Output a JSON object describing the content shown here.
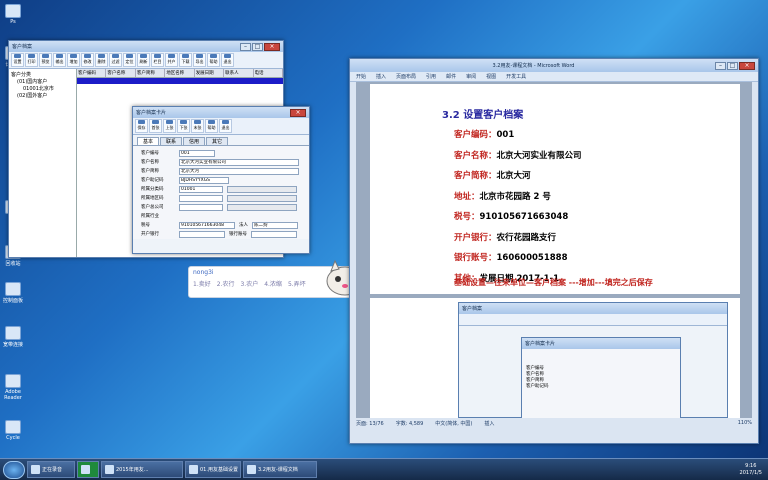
{
  "desktop": {
    "icons": [
      "Ps",
      "计算机",
      "网络",
      "回收站",
      "控制面板",
      "宽带连接",
      "Adobe Reader",
      "Cycle"
    ]
  },
  "archive_window": {
    "title": "客户档案",
    "toolbar": [
      "设置",
      "打印",
      "预览",
      "输出",
      "增加",
      "修改",
      "删除",
      "过滤",
      "定位",
      "刷新",
      "栏目",
      "并户",
      "下载",
      "导出",
      "帮助",
      "退出"
    ],
    "tree": {
      "root": "客户分类",
      "items": [
        "(01)国内客户",
        "01001北京市",
        "(02)国外客户"
      ]
    },
    "columns": [
      "客户编码",
      "客户名称",
      "客户简称",
      "地区名称",
      "发展日期",
      "联系人",
      "电话"
    ]
  },
  "card_window": {
    "title": "客户档案卡片",
    "toolbar": [
      "保存",
      "首张",
      "上张",
      "下张",
      "末张",
      "帮助",
      "退出"
    ],
    "tabs": [
      "基本",
      "联系",
      "信用",
      "其它"
    ],
    "fields": [
      {
        "label": "客户编号",
        "value": "001"
      },
      {
        "label": "客户名称",
        "value": "北京大河实业有限公司"
      },
      {
        "label": "客户简称",
        "value": "北京大河"
      },
      {
        "label": "客户助记码",
        "value": "BJDHSYYXGS"
      },
      {
        "label": "所属分类码",
        "value": "01001"
      },
      {
        "label": "所属地区码",
        "value": ""
      },
      {
        "label": "客户总公司",
        "value": ""
      },
      {
        "label": "所属行业",
        "value": ""
      }
    ],
    "tax": {
      "label": "税号",
      "value": "910105671663048"
    },
    "legal": {
      "label": "法人",
      "value": "陈二狗"
    },
    "bank": {
      "label": "开户银行",
      "value": ""
    },
    "account": {
      "label": "银行账号",
      "value": ""
    }
  },
  "chat": {
    "name": "nong3i",
    "items": [
      "1.卖好",
      "2.农行",
      "3.农户",
      "4.浓缩",
      "5.弄坏"
    ]
  },
  "word": {
    "title": "3.2用友-课程文档 - Microsoft Word",
    "tabs": [
      "开始",
      "插入",
      "页面布局",
      "引用",
      "邮件",
      "审阅",
      "视图",
      "开发工具"
    ],
    "heading": "3.2 设置客户档案",
    "lines": [
      {
        "k": "客户编码：",
        "v": "001"
      },
      {
        "k": "客户名称：",
        "v": "北京大河实业有限公司"
      },
      {
        "k": "客户简称：",
        "v": "北京大河"
      },
      {
        "k": "地址：",
        "v": "北京市花园路 2 号"
      },
      {
        "k": "税号：",
        "v": "910105671663048"
      },
      {
        "k": "开户银行：",
        "v": "农行花园路支行"
      },
      {
        "k": "银行账号：",
        "v": "160600051888"
      },
      {
        "k": "其他：",
        "v": "发展日期 2017-1-1"
      }
    ],
    "instruction": "基础设置—往来单位—客户档案 ---增加---填完之后保存",
    "status": {
      "page": "页面: 13/76",
      "words": "字数: 4,589",
      "lang": "中文(简体, 中国)",
      "mode": "插入",
      "zoom": "110%"
    }
  },
  "taskbar": {
    "items": [
      "正在录音",
      "2015年用友...",
      "01.用友基础设置",
      "3.2用友-课程文档"
    ],
    "time": "9:16",
    "date": "2017/1/5"
  },
  "colors": {
    "heading": "#2a2aa0",
    "field_key": "#c0241e"
  }
}
